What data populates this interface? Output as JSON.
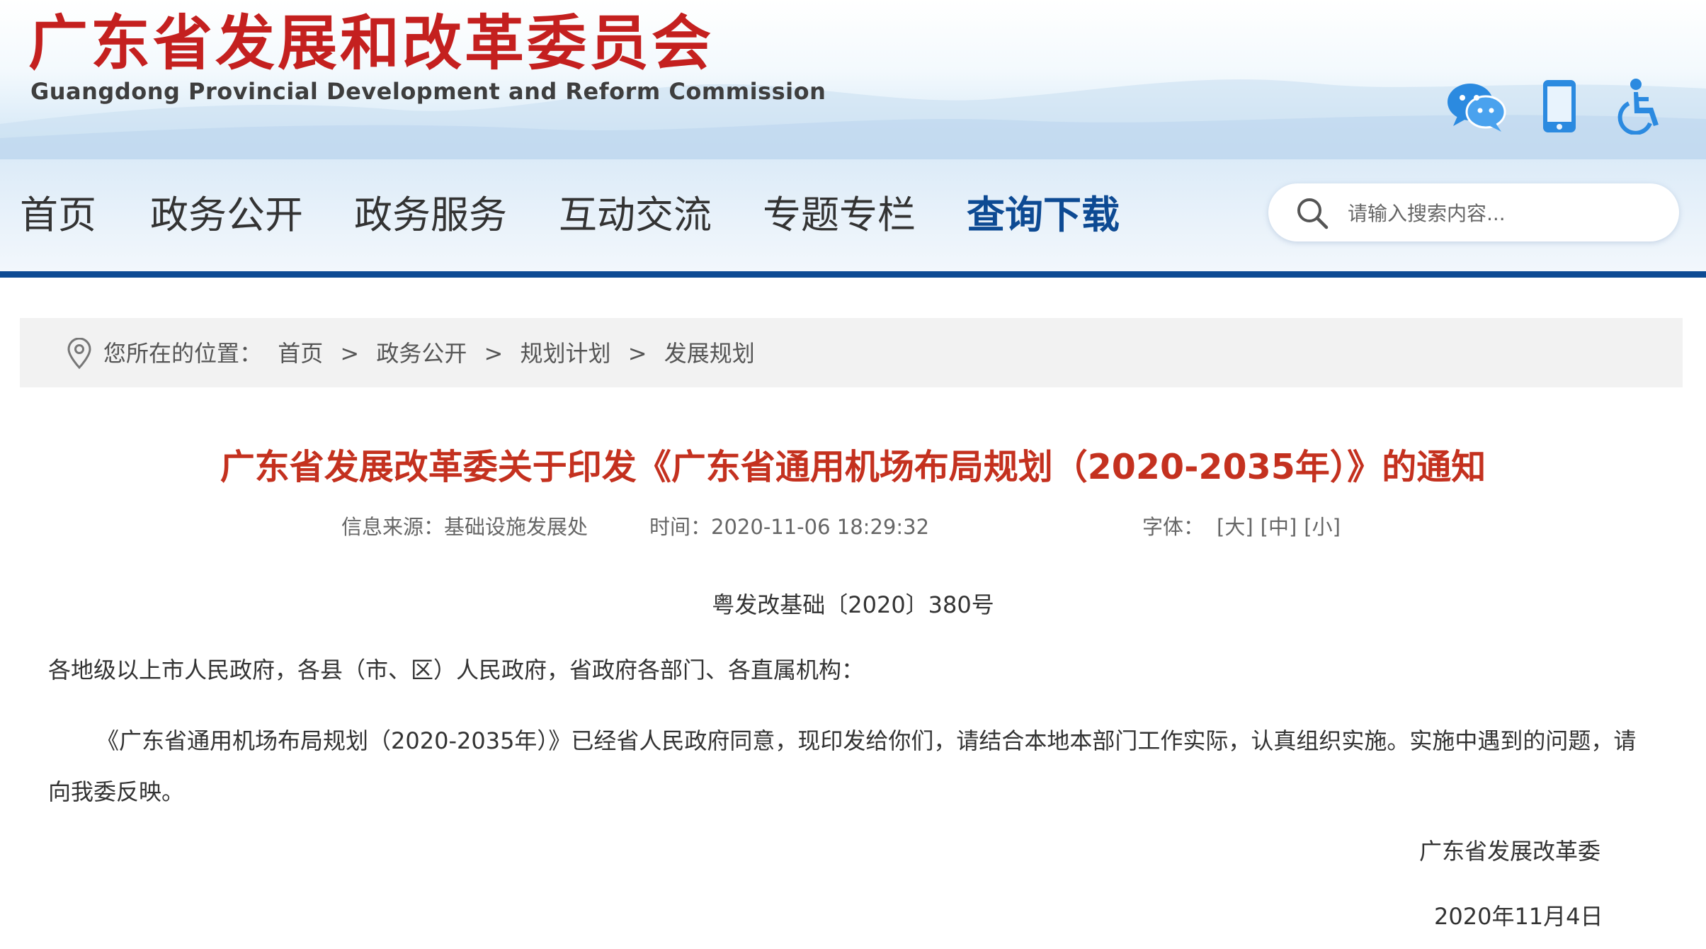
{
  "header": {
    "title": "广东省发展和改革委员会",
    "subtitle": "Guangdong Provincial Development and Reform Commission",
    "icons": [
      "wechat-icon",
      "mobile-icon",
      "accessibility-icon"
    ]
  },
  "nav": {
    "items": [
      {
        "label": "首页",
        "active": false
      },
      {
        "label": "政务公开",
        "active": false
      },
      {
        "label": "政务服务",
        "active": false
      },
      {
        "label": "互动交流",
        "active": false
      },
      {
        "label": "专题专栏",
        "active": false
      },
      {
        "label": "查询下载",
        "active": true
      }
    ]
  },
  "search": {
    "placeholder": "请输入搜索内容...",
    "value": ""
  },
  "breadcrumb": {
    "prefix": "您所在的位置：",
    "items": [
      "首页",
      "政务公开",
      "规划计划",
      "发展规划"
    ],
    "separator": ">"
  },
  "article": {
    "title": "广东省发展改革委关于印发《广东省通用机场布局规划（2020-2035年）》的通知",
    "meta": {
      "source_label": "信息来源：",
      "source": "基础设施发展处",
      "time_label": "时间：",
      "time": "2020-11-06 18:29:32",
      "font_label": "字体：",
      "font_sizes": [
        "[大]",
        "[中]",
        "[小]"
      ]
    },
    "doc_number": "粤发改基础〔2020〕380号",
    "salutation": "各地级以上市人民政府，各县（市、区）人民政府，省政府各部门、各直属机构：",
    "body": "《广东省通用机场布局规划（2020-2035年）》已经省人民政府同意，现印发给你们，请结合本地本部门工作实际，认真组织实施。实施中遇到的问题，请向我委反映。",
    "signature": "广东省发展改革委",
    "date": "2020年11月4日"
  },
  "colors": {
    "brand_red": "#c4201f",
    "title_red": "#c4311f",
    "nav_blue": "#0d4a93",
    "icon_blue": "#2b8ae0"
  }
}
